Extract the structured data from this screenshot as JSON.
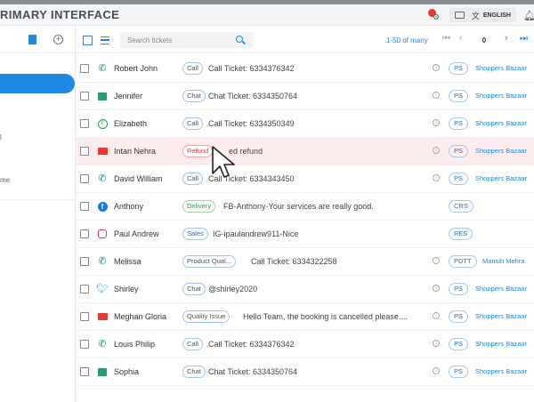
{
  "app": {
    "title": "RIMARY INTERFACE"
  },
  "header": {
    "language": "ENGLISH"
  },
  "sidebar": {
    "frag1": "l",
    "frag2": "me"
  },
  "toolbar": {
    "search_placeholder": "Search tickets",
    "range": "1-50 of many",
    "page": "0"
  },
  "tickets": [
    {
      "channel": "phone-icon",
      "name": "Robert John",
      "tag": "Call",
      "subject": "Call Ticket: 6334376342",
      "badge": "PS",
      "company": "Shoppers Bazaar"
    },
    {
      "channel": "chat-icon",
      "name": "Jennifer",
      "tag": "Chat",
      "subject": "Chat Ticket: 6334350764",
      "badge": "PS",
      "company": "Shoppers Bazaar"
    },
    {
      "channel": "whatsapp-icon",
      "name": "Elizabeth",
      "tag": "Call",
      "subject": "Call Ticket: 6334350349",
      "badge": "PS",
      "company": "Shoppers Bazaar"
    },
    {
      "channel": "mail-icon",
      "name": "Intan Nehra",
      "tag": "Refund",
      "subject": "ed refund",
      "badge": "PS",
      "company": "Shoppers Bazaar"
    },
    {
      "channel": "phone-icon",
      "name": "David William",
      "tag": "Call",
      "subject": "Call Ticket: 6334343450",
      "badge": "PS",
      "company": "Shoppers Bazaar"
    },
    {
      "channel": "facebook-icon",
      "name": "Anthony",
      "tag": "Delivery",
      "subject": "FB-Anthony-Your services are really good.",
      "badge": "CRS",
      "company": ""
    },
    {
      "channel": "instagram-icon",
      "name": "Paul Andrew",
      "tag": "Sales",
      "subject": "IG-ipaulandrew911-Nice",
      "badge": "RES",
      "company": ""
    },
    {
      "channel": "phone-icon",
      "name": "Melissa",
      "tag": "Product Qual...",
      "subject": "Call Ticket: 6334322258",
      "badge": "PDTT",
      "company": "Mansih Mehra"
    },
    {
      "channel": "twitter-icon",
      "name": "Shirley",
      "tag": "Chat",
      "subject": "@shirley2020",
      "badge": "PS",
      "company": "Shoppers Bazaar"
    },
    {
      "channel": "mail-icon",
      "name": "Meghan Gloria",
      "tag": "Quality Issue",
      "subject": "Hello Team, the booking is cancelled please....",
      "badge": "PS",
      "company": "Shoppers Bazaar"
    },
    {
      "channel": "phone-icon",
      "name": "Louis Philip",
      "tag": "Call",
      "subject": "Call Ticket: 6334376342",
      "badge": "PS",
      "company": "Shoppers Bazaar"
    },
    {
      "channel": "chat-icon",
      "name": "Sophia",
      "tag": "Chat",
      "subject": "Chat Ticket: 6334350764",
      "badge": "PS",
      "company": "Shoppers Bazaar"
    }
  ]
}
